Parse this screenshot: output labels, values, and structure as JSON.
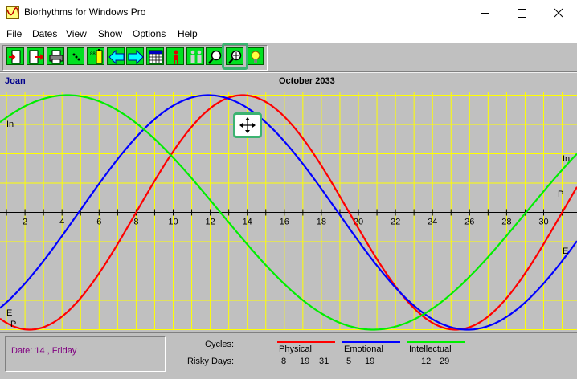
{
  "window": {
    "title": "Biorhythms for Windows Pro",
    "controls": {
      "minimize": "minimize",
      "maximize": "maximize",
      "close": "close"
    }
  },
  "menu": [
    "File",
    "Dates",
    "View",
    "Show",
    "Options",
    "Help"
  ],
  "toolbar": {
    "buttons": [
      {
        "name": "exit",
        "icon": "door-exit-icon"
      },
      {
        "name": "open",
        "icon": "door-enter-icon"
      },
      {
        "name": "print",
        "icon": "printer-icon"
      },
      {
        "name": "dice",
        "icon": "dice-icon"
      },
      {
        "name": "battery",
        "icon": "battery-icon"
      },
      {
        "name": "prev-month",
        "icon": "arrow-left-icon"
      },
      {
        "name": "next-month",
        "icon": "arrow-right-icon"
      },
      {
        "name": "calendar",
        "icon": "calendar-grid-icon"
      },
      {
        "name": "person",
        "icon": "person-icon"
      },
      {
        "name": "compatibility",
        "icon": "people-icon"
      },
      {
        "name": "zoom",
        "icon": "magnifier-icon"
      },
      {
        "name": "move-chart",
        "icon": "magnifier-move-icon",
        "active": true
      },
      {
        "name": "hint",
        "icon": "lightbulb-icon"
      }
    ]
  },
  "chart": {
    "person": "Joan",
    "title": "October 2033",
    "labels": {
      "intellectual_right": "In",
      "physical_right": "P",
      "emotional_right": "E",
      "intellectual_left": "In",
      "emotional_left": "E",
      "physical_left": "P"
    }
  },
  "chart_data": {
    "type": "line",
    "title": "October 2033",
    "xlabel": "",
    "ylabel": "",
    "x_ticks": [
      "2",
      "4",
      "6",
      "8",
      "10",
      "12",
      "14",
      "16",
      "18",
      "20",
      "22",
      "24",
      "26",
      "28",
      "30"
    ],
    "xlim": [
      1,
      31
    ],
    "ylim": [
      -1,
      1
    ],
    "grid": true,
    "series": [
      {
        "name": "Physical",
        "period": 23,
        "peak_day": 13.75,
        "color": "#ff0000"
      },
      {
        "name": "Emotional",
        "period": 28,
        "peak_day": 11.9,
        "color": "#0000ff"
      },
      {
        "name": "Intellectual",
        "period": 33,
        "peak_day": 4.3,
        "color": "#00ee00"
      }
    ]
  },
  "status": {
    "date": "Date: 14 ,  Friday",
    "cycles_label": "Cycles:",
    "risky_label": "Risky Days:",
    "legend": [
      {
        "name": "Physical",
        "color": "#ff0000",
        "risky": [
          "8",
          "19",
          "31"
        ]
      },
      {
        "name": "Emotional",
        "color": "#0000ff",
        "risky": [
          "5",
          "19"
        ]
      },
      {
        "name": "Intellectual",
        "color": "#00ee00",
        "risky": [
          "12",
          "29"
        ]
      }
    ]
  }
}
